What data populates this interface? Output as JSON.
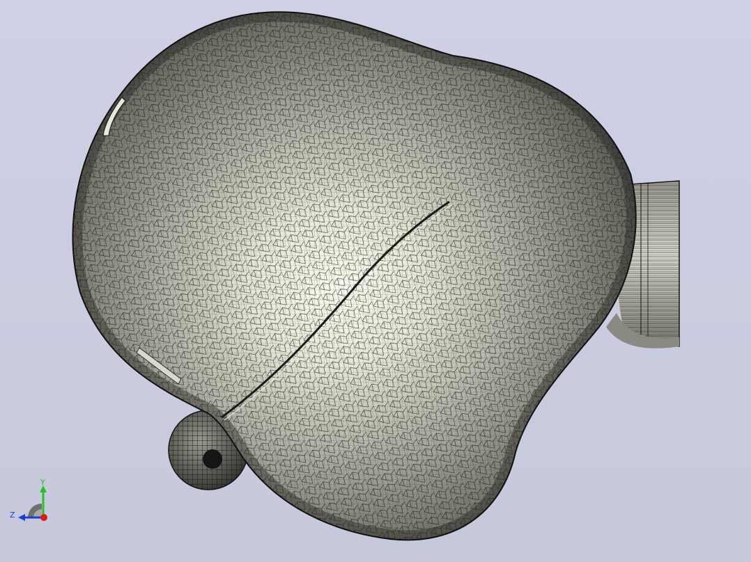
{
  "viewport": {
    "background_top": "#cfd0e6",
    "background_bottom": "#c6c8db",
    "mesh_color": "#141414",
    "surface_light": "#fbfbef",
    "surface_dark": "#5a5a54"
  },
  "triad": {
    "y_label": "Y",
    "z_label": "Z",
    "y_color": "#22c322",
    "z_color": "#1e3cd8",
    "x_color": "#e01818"
  }
}
